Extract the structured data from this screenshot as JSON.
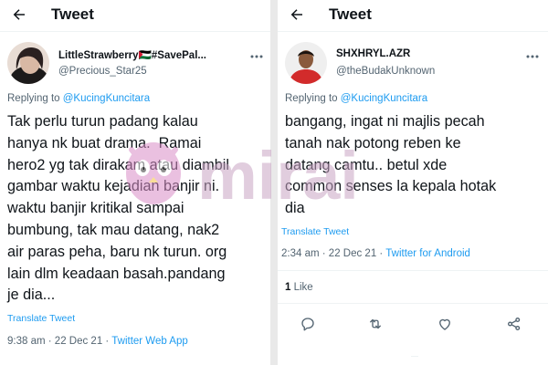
{
  "left_tweet": {
    "header_title": "Tweet",
    "display_name": "LittleStrawberry🇵🇸#SavePal...",
    "handle": "@Precious_Star25",
    "replying_prefix": "Replying to ",
    "replying_to": "@KucingKuncitara",
    "text_lines": [
      "Tak perlu turun padang kalau",
      "hanya nk buat drama.  Ramai",
      "hero2 yg tak dirakam atau diambil",
      "gambar waktu kejadian banjir ni.",
      "waktu banjir kritikal sampai",
      "bumbung, tak mau datang, nak2",
      "air paras peha, baru nk turun. org",
      "lain dlm keadaan basah.pandang",
      "je dia..."
    ],
    "translate_label": "Translate Tweet",
    "time": "9:38 am",
    "date": "22 Dec 21",
    "source": "Twitter Web App"
  },
  "right_tweet": {
    "header_title": "Tweet",
    "display_name": "SHXHRYL.AZR",
    "handle": "@theBudakUnknown",
    "replying_prefix": "Replying to ",
    "replying_to": "@KucingKuncitara",
    "text_lines": [
      "bangang, ingat ni majlis pecah",
      "tanah nak potong reben ke",
      "datang camtu.. betul xde",
      "common senses la kepala hotak",
      "dia"
    ],
    "translate_label": "Translate Tweet",
    "time": "2:34 am",
    "date": "22 Dec 21",
    "source": "Twitter for Android",
    "like_count": "1",
    "like_label": "Like"
  },
  "watermark": {
    "text": "mirai"
  },
  "colors": {
    "accent": "#1d9bf0",
    "muted": "#536471",
    "text": "#0f1419",
    "watermark": "#c9a5c4"
  },
  "icons": [
    "back-arrow-icon",
    "more-options-icon",
    "reply-icon",
    "retweet-icon",
    "like-icon",
    "share-icon"
  ]
}
